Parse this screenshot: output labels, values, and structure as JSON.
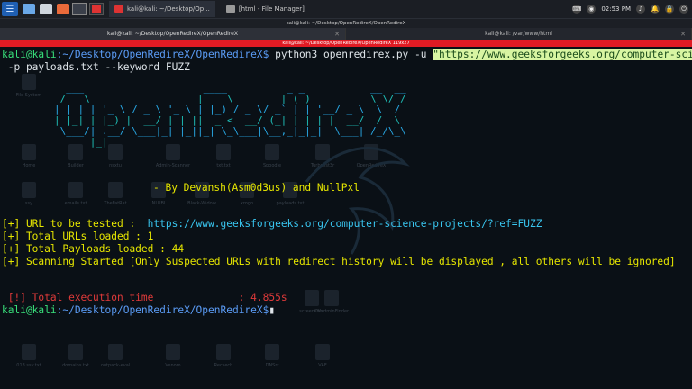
{
  "panel": {
    "tasks": [
      {
        "label": "kali@kali: ~/Desktop/Op...",
        "active": true
      },
      {
        "label": "[html - File Manager]",
        "active": false
      }
    ],
    "clock": "02:53 PM"
  },
  "window": {
    "title": "kali@kali: ~/Desktop/OpenRedireX/OpenRedireX",
    "tabs": [
      {
        "label": "kali@kali: ~/Desktop/OpenRedireX/OpenRedireX"
      },
      {
        "label": "kali@kali: /var/www/html"
      }
    ],
    "status_bar": "kali@kali: ~/Desktop/OpenRedireX/OpenRedireX 119x27"
  },
  "desktop_icons": [
    "File System",
    "Home",
    "Builder",
    "nsxtu",
    "Admin-Scanner",
    "txt.txt",
    "Spoodle",
    "Turbolist3r",
    "OpenRedireX",
    "ssy",
    "emails.txt",
    "TheFatRat",
    "NLUBI",
    "Black-Widow",
    "xrogo",
    "payloads.txt",
    "screenshot",
    "OKadminFinder",
    "013.ssv.txt",
    "domains.txt",
    "outpack-eval",
    "Venom",
    "Recsech",
    "DNSrr",
    "VAF"
  ],
  "terminal": {
    "prompt_user": "kali@kali",
    "prompt_path": ":~/Desktop/OpenRedireX/OpenRedireX$",
    "command_pre": " python3 openredirex.py -u ",
    "command_url": "\"https://www.geeksforgeeks.org/computer-science-projects/?ref=FUZZ\"",
    "command_post": " -p payloads.txt --keyword FUZZ",
    "ascii_art": [
      "  ___                    ____          _ _           __  __",
      " / _ \\ _ __   ___ _ __  |  _ \\ ___  __| (_)_ __ ___  \\ \\/ /",
      "| | | | '_ \\ / _ \\ '_ \\ | |_) / _ \\/ _` | | '__/ _ \\  \\  /",
      "| |_| | |_) |  __/ | | ||  _ <  __/ (_| | | | |  __/  /  \\",
      " \\___/| .__/ \\___|_| |_||_| \\_\\___|\\__,_|_|_|  \\___| /_/\\_\\",
      "      |_|"
    ],
    "credits": "- By Devansh(Asm0d3us) and NullPxl",
    "url_label": "[+] URL to be tested :  ",
    "url_value": "https://www.geeksforgeeks.org/computer-science-projects/?ref=FUZZ",
    "total_urls": "[+] Total URLs loaded : 1",
    "total_payloads": "[+] Total Payloads loaded : 44",
    "scanning": "[+] Scanning Started [Only Suspected URLs with redirect history will be displayed , all others will be ignored]",
    "exec_time": " [!] Total execution time              : 4.855s",
    "final_prompt_user": "kali@kali",
    "final_prompt_path": ":~/Desktop/OpenRedireX/OpenRedireX$"
  }
}
